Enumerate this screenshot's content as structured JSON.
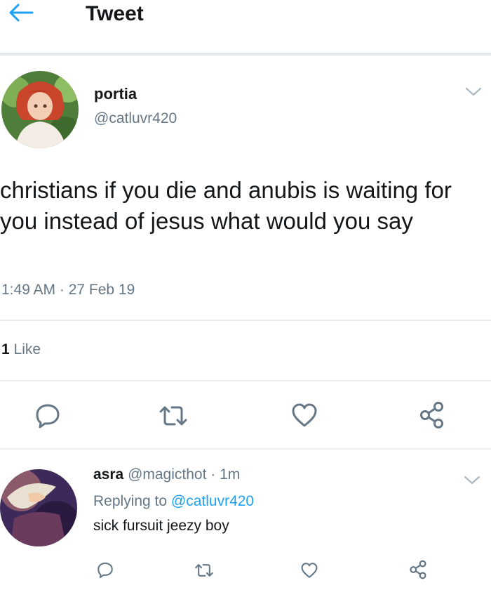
{
  "header": {
    "title": "Tweet",
    "back_icon": "arrow-left-icon",
    "accent": "#1da1f2"
  },
  "tweet": {
    "display_name": "portia",
    "handle": "@catluvr420",
    "text": "christians if you die and anubis is waiting for you instead of jesus what would you say",
    "timestamp": "1:49 AM · 27 Feb 19",
    "likes_count": "1",
    "likes_label": "Like",
    "actions": [
      "reply-icon",
      "retweet-icon",
      "like-icon",
      "share-icon"
    ]
  },
  "reply": {
    "display_name": "asra",
    "handle": "@magicthot",
    "time": "· 1m",
    "replying_prefix": "Replying to",
    "replying_handle": "@catluvr420",
    "text": "sick fursuit jeezy boy"
  },
  "colors": {
    "text": "#14171a",
    "secondary": "#657786",
    "divider": "#e6ecf0",
    "link": "#1da1f2"
  }
}
